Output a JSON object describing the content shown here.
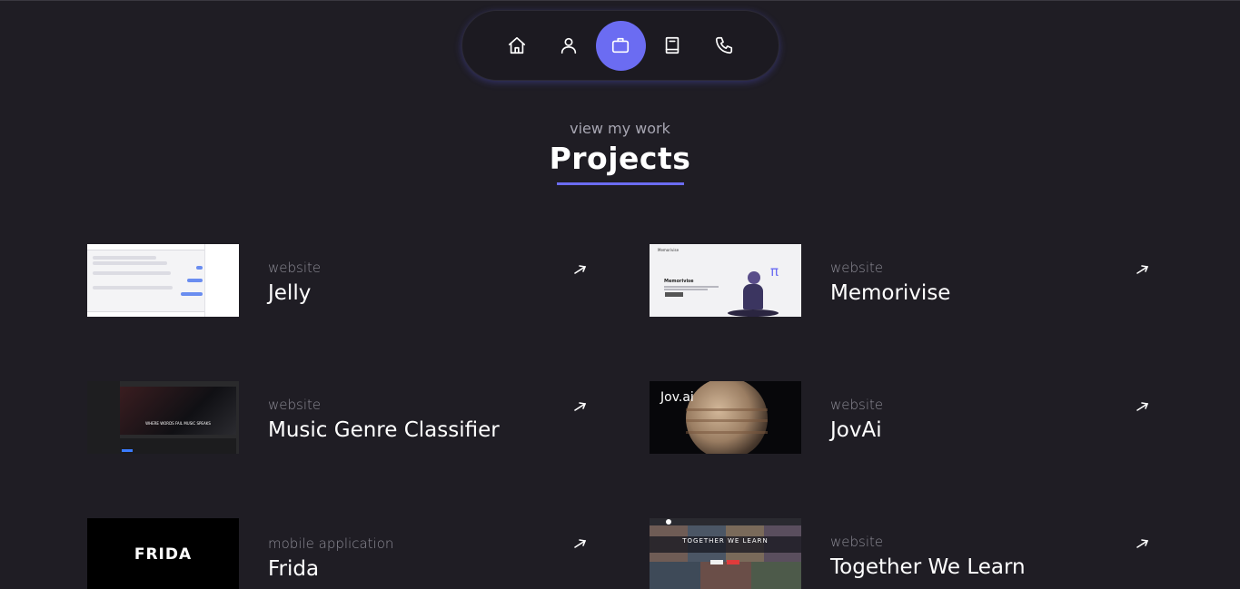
{
  "nav": {
    "items": [
      {
        "icon": "home-icon",
        "active": false
      },
      {
        "icon": "user-icon",
        "active": false
      },
      {
        "icon": "briefcase-icon",
        "active": true
      },
      {
        "icon": "book-icon",
        "active": false
      },
      {
        "icon": "phone-icon",
        "active": false
      }
    ]
  },
  "section": {
    "subtitle": "view my work",
    "title": "Projects"
  },
  "projects": [
    {
      "kind": "website",
      "name": "Jelly"
    },
    {
      "kind": "website",
      "name": "Memorivise"
    },
    {
      "kind": "website",
      "name": "Music Genre Classifier"
    },
    {
      "kind": "website",
      "name": "JovAi"
    },
    {
      "kind": "mobile application",
      "name": "Frida"
    },
    {
      "kind": "website",
      "name": "Together We Learn"
    }
  ],
  "thumbnails": {
    "memorivise_header": "Memorivise",
    "memorivise_heading": "Memorivise",
    "memorivise_symbol": "π",
    "music_banner": "WHERE WORDS FAIL MUSIC SPEAKS",
    "jovai_logo": "Jov.ai",
    "frida_logo": "FRIDA",
    "twl_banner": "TOGETHER WE LEARN"
  },
  "colors": {
    "background": "#1f1d24",
    "accent": "#6b6cf2"
  }
}
